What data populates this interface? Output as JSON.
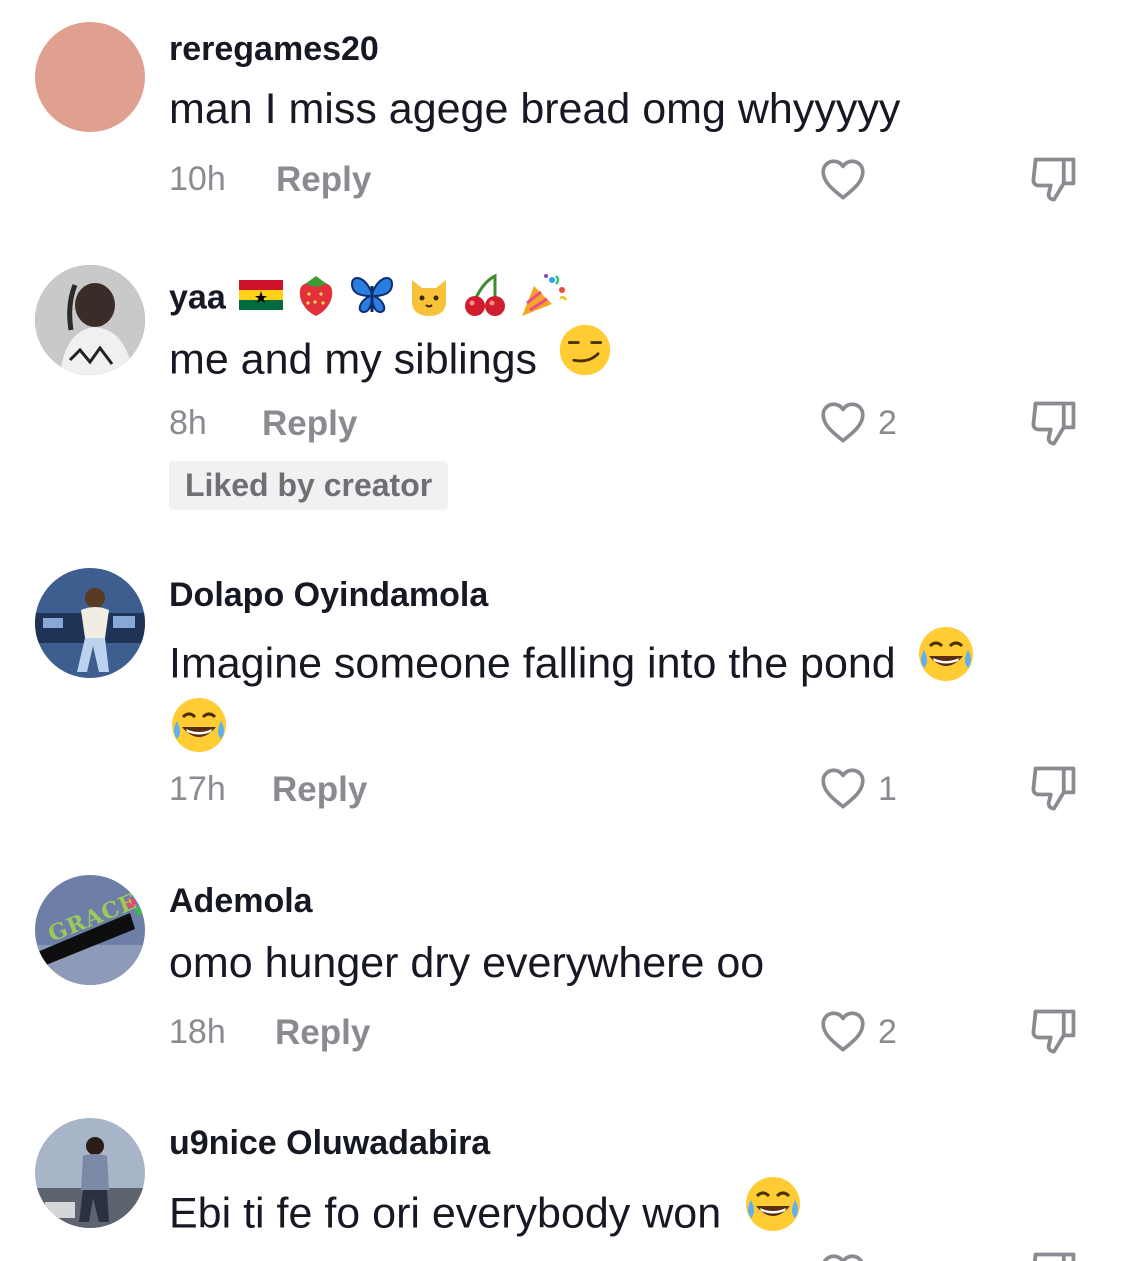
{
  "comments": [
    {
      "username": "reregames20",
      "text": "man I miss agege bread omg whyyyyy",
      "time": "10h",
      "reply_label": "Reply",
      "likes": "",
      "avatar_color": "#e0a090"
    },
    {
      "username": "yaa",
      "username_emojis": [
        "ghana-flag-icon",
        "strawberry-icon",
        "butterfly-icon",
        "cat-icon",
        "cherries-icon",
        "party-popper-icon"
      ],
      "text": "me and my siblings",
      "time": "8h",
      "reply_label": "Reply",
      "likes": "2",
      "badge": "Liked by creator"
    },
    {
      "username": "Dolapo Oyindamola",
      "text": "Imagine someone falling into the pond",
      "time": "17h",
      "reply_label": "Reply",
      "likes": "1"
    },
    {
      "username": "Ademola",
      "avatar_text": "GRACE",
      "text": "omo hunger dry everywhere oo",
      "time": "18h",
      "reply_label": "Reply",
      "likes": "2"
    },
    {
      "username": "u9nice Oluwadabira",
      "text": "Ebi ti fe fo ori everybody won",
      "time": "",
      "reply_label": "",
      "likes": ""
    }
  ],
  "colors": {
    "primary_text": "#161823",
    "secondary_text": "#8a8b91",
    "badge_bg": "#f1f1f2"
  }
}
